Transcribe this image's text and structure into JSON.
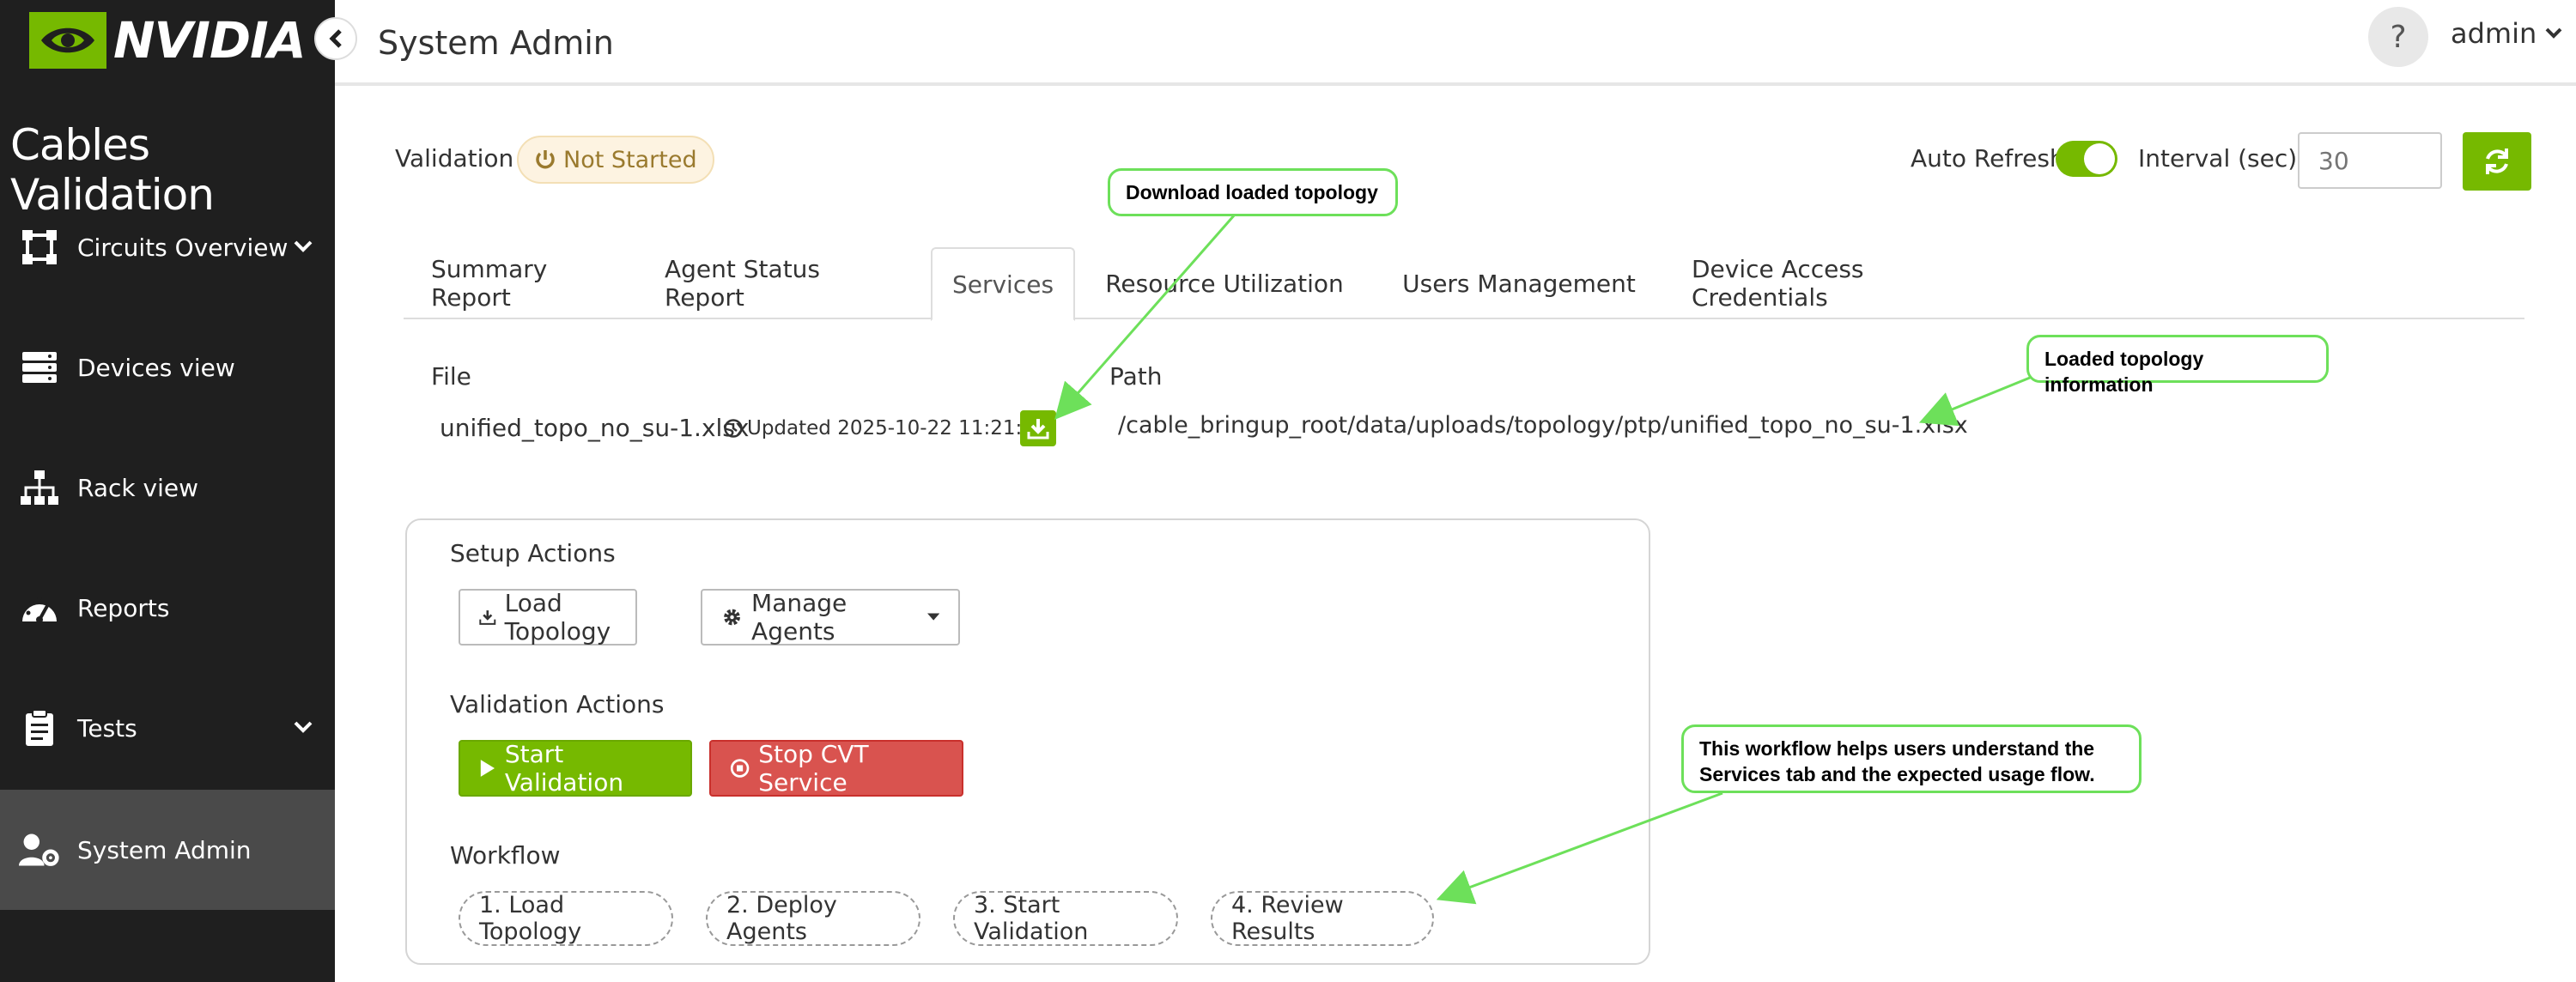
{
  "brand": {
    "logo_text": "NVIDIA",
    "app_title": "Cables Validation",
    "accent": "#76b900"
  },
  "sidebar": {
    "items": [
      {
        "label": "Circuits Overview",
        "icon": "circuit-icon",
        "has_submenu": true
      },
      {
        "label": "Devices view",
        "icon": "server-icon",
        "has_submenu": false
      },
      {
        "label": "Rack view",
        "icon": "sitemap-icon",
        "has_submenu": false
      },
      {
        "label": "Reports",
        "icon": "dashboard-icon",
        "has_submenu": false
      },
      {
        "label": "Tests",
        "icon": "clipboard-icon",
        "has_submenu": true
      },
      {
        "label": "System Admin",
        "icon": "users-cog-icon",
        "has_submenu": false,
        "active": true
      }
    ]
  },
  "topbar": {
    "title": "System Admin",
    "help": "?",
    "user": "admin"
  },
  "validation": {
    "label": "Validation",
    "status": "Not Started",
    "auto_refresh_label": "Auto Refresh",
    "auto_refresh_on": true,
    "interval_label": "Interval (sec)",
    "interval_placeholder": "30"
  },
  "tabs": [
    {
      "label": "Summary Report"
    },
    {
      "label": "Agent Status Report"
    },
    {
      "label": "Services",
      "active": true
    },
    {
      "label": "Resource Utilization"
    },
    {
      "label": "Users Management"
    },
    {
      "label": "Device Access Credentials"
    }
  ],
  "file_info": {
    "file_label": "File",
    "path_label": "Path",
    "file_name": "unified_topo_no_su-1.xlsx",
    "updated": "Updated 2025-10-22 11:21:07",
    "path": "/cable_bringup_root/data/uploads/topology/ptp/unified_topo_no_su-1.xlsx"
  },
  "setup": {
    "title": "Setup Actions",
    "load_topology": "Load Topology",
    "manage_agents": "Manage Agents"
  },
  "validation_actions": {
    "title": "Validation Actions",
    "start": "Start Validation",
    "stop": "Stop CVT Service"
  },
  "workflow": {
    "title": "Workflow",
    "steps": [
      "1. Load Topology",
      "2. Deploy Agents",
      "3. Start Validation",
      "4. Review Results"
    ]
  },
  "callouts": {
    "download": "Download loaded topology",
    "topology_info": "Loaded topology information",
    "workflow_line1": "This workflow helps users understand the",
    "workflow_line2": "Services tab and the expected usage flow."
  }
}
